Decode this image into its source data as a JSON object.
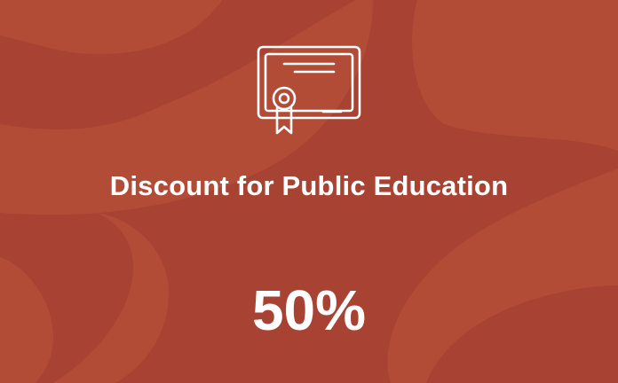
{
  "card": {
    "icon": "certificate-icon",
    "title": "Discount for Public Education",
    "value": "50%"
  },
  "colors": {
    "background": "#a84232",
    "shape_light": "#b34c37",
    "text": "#ffffff"
  }
}
